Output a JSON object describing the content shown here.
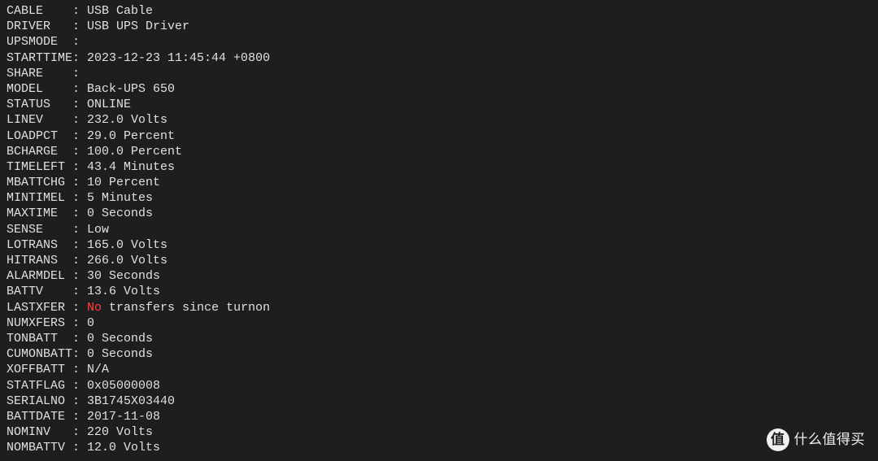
{
  "rows": [
    {
      "key": "CABLE    ",
      "value": "USB Cable"
    },
    {
      "key": "DRIVER   ",
      "value": "USB UPS Driver"
    },
    {
      "key": "UPSMODE  ",
      "value": ""
    },
    {
      "key": "STARTTIME",
      "value": "2023-12-23 11:45:44 +0800"
    },
    {
      "key": "SHARE    ",
      "value": ""
    },
    {
      "key": "MODEL    ",
      "value": "Back-UPS 650"
    },
    {
      "key": "STATUS   ",
      "value": "ONLINE"
    },
    {
      "key": "LINEV    ",
      "value": "232.0 Volts"
    },
    {
      "key": "LOADPCT  ",
      "value": "29.0 Percent"
    },
    {
      "key": "BCHARGE  ",
      "value": "100.0 Percent"
    },
    {
      "key": "TIMELEFT ",
      "value": "43.4 Minutes"
    },
    {
      "key": "MBATTCHG ",
      "value": "10 Percent"
    },
    {
      "key": "MINTIMEL ",
      "value": "5 Minutes"
    },
    {
      "key": "MAXTIME  ",
      "value": "0 Seconds"
    },
    {
      "key": "SENSE    ",
      "value": "Low"
    },
    {
      "key": "LOTRANS  ",
      "value": "165.0 Volts"
    },
    {
      "key": "HITRANS  ",
      "value": "266.0 Volts"
    },
    {
      "key": "ALARMDEL ",
      "value": "30 Seconds"
    },
    {
      "key": "BATTV    ",
      "value": "13.6 Volts"
    },
    {
      "key": "LASTXFER ",
      "highlight": "No",
      "value_rest": " transfers since turnon"
    },
    {
      "key": "NUMXFERS ",
      "value": "0"
    },
    {
      "key": "TONBATT  ",
      "value": "0 Seconds"
    },
    {
      "key": "CUMONBATT",
      "value": "0 Seconds"
    },
    {
      "key": "XOFFBATT ",
      "value": "N/A"
    },
    {
      "key": "STATFLAG ",
      "value": "0x05000008"
    },
    {
      "key": "SERIALNO ",
      "value": "3B1745X03440"
    },
    {
      "key": "BATTDATE ",
      "value": "2017-11-08"
    },
    {
      "key": "NOMINV   ",
      "value": "220 Volts"
    },
    {
      "key": "NOMBATTV ",
      "value": "12.0 Volts"
    }
  ],
  "separator": ": ",
  "watermark": {
    "logo_text": "值",
    "brand_text": "什么值得买"
  }
}
